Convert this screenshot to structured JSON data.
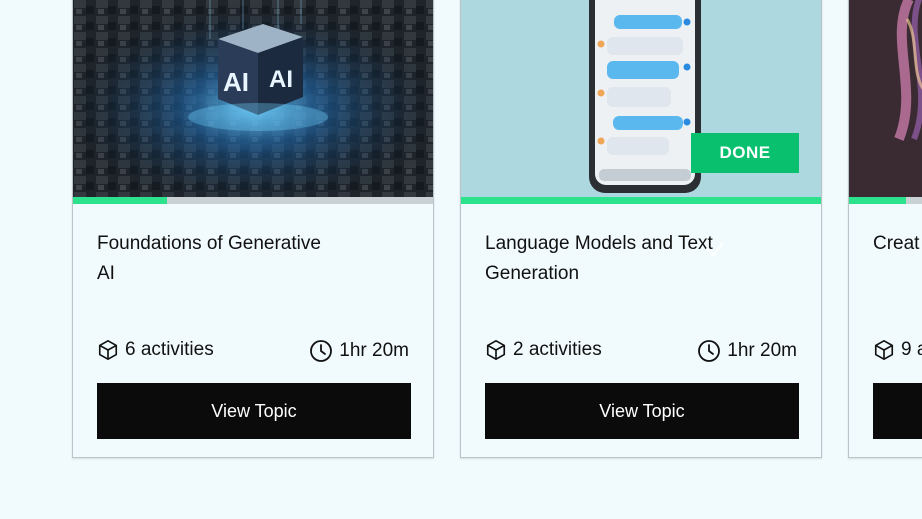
{
  "cards": [
    {
      "image_description_name": "ai-cube-image",
      "title": "Foundations of Generative AI",
      "activities": "6 activities",
      "duration": "1hr 20m",
      "button_label": "View Topic",
      "progress_fraction": 0.26
    },
    {
      "image_description_name": "phone-chat-image",
      "title": "Language Models and Text Generation",
      "badge": "DONE",
      "activities": "2 activities",
      "duration": "1hr 20m",
      "button_label": "View Topic",
      "progress_fraction": 1.0
    },
    {
      "image_description_name": "abstract-3d-image",
      "title": "Creat",
      "activities": "9 a",
      "progress_fraction": 0.16
    }
  ],
  "colors": {
    "page_bg": "#f1fbfd",
    "progress_fill": "#2de28c",
    "done_badge": "#08c06d",
    "button_bg": "#0b0b0b"
  }
}
